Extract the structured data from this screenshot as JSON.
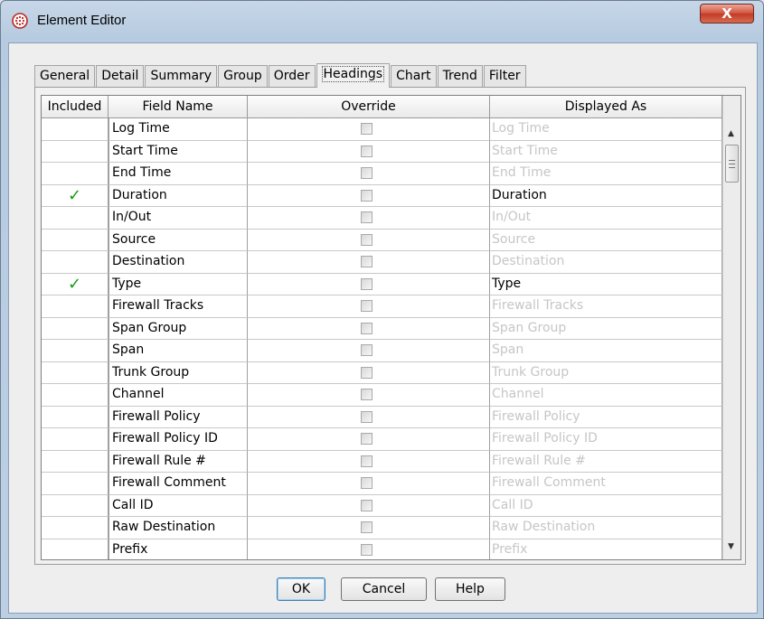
{
  "window": {
    "title": "Element Editor",
    "close_glyph": "X",
    "app_icon": "globe-logo-icon"
  },
  "tabs": [
    {
      "label": "General",
      "active": false
    },
    {
      "label": "Detail",
      "active": false
    },
    {
      "label": "Summary",
      "active": false
    },
    {
      "label": "Group",
      "active": false
    },
    {
      "label": "Order",
      "active": false
    },
    {
      "label": "Headings",
      "active": true
    },
    {
      "label": "Chart",
      "active": false
    },
    {
      "label": "Trend",
      "active": false
    },
    {
      "label": "Filter",
      "active": false
    }
  ],
  "table": {
    "columns": [
      "Included",
      "Field Name",
      "Override",
      "Displayed As"
    ],
    "rows": [
      {
        "included": false,
        "field": "Log Time",
        "override": false,
        "displayed": "Log Time"
      },
      {
        "included": false,
        "field": "Start Time",
        "override": false,
        "displayed": "Start Time"
      },
      {
        "included": false,
        "field": "End Time",
        "override": false,
        "displayed": "End Time"
      },
      {
        "included": true,
        "field": "Duration",
        "override": false,
        "displayed": "Duration"
      },
      {
        "included": false,
        "field": "In/Out",
        "override": false,
        "displayed": "In/Out"
      },
      {
        "included": false,
        "field": "Source",
        "override": false,
        "displayed": "Source"
      },
      {
        "included": false,
        "field": "Destination",
        "override": false,
        "displayed": "Destination"
      },
      {
        "included": true,
        "field": "Type",
        "override": false,
        "displayed": "Type"
      },
      {
        "included": false,
        "field": "Firewall Tracks",
        "override": false,
        "displayed": "Firewall Tracks"
      },
      {
        "included": false,
        "field": "Span Group",
        "override": false,
        "displayed": "Span Group"
      },
      {
        "included": false,
        "field": "Span",
        "override": false,
        "displayed": "Span"
      },
      {
        "included": false,
        "field": "Trunk Group",
        "override": false,
        "displayed": "Trunk Group"
      },
      {
        "included": false,
        "field": "Channel",
        "override": false,
        "displayed": "Channel"
      },
      {
        "included": false,
        "field": "Firewall Policy",
        "override": false,
        "displayed": "Firewall Policy"
      },
      {
        "included": false,
        "field": "Firewall Policy ID",
        "override": false,
        "displayed": "Firewall Policy ID"
      },
      {
        "included": false,
        "field": "Firewall Rule #",
        "override": false,
        "displayed": "Firewall Rule #"
      },
      {
        "included": false,
        "field": "Firewall Comment",
        "override": false,
        "displayed": "Firewall Comment"
      },
      {
        "included": false,
        "field": "Call ID",
        "override": false,
        "displayed": "Call ID"
      },
      {
        "included": false,
        "field": "Raw Destination",
        "override": false,
        "displayed": "Raw Destination"
      },
      {
        "included": false,
        "field": "Prefix",
        "override": false,
        "displayed": "Prefix"
      }
    ],
    "check_glyph": "✓"
  },
  "scrollbar": {
    "up_glyph": "▲",
    "down_glyph": "▼"
  },
  "buttons": {
    "ok": "OK",
    "cancel": "Cancel",
    "help": "Help"
  },
  "colors": {
    "check": "#1a9c1a",
    "dim_text": "#c6c6c6",
    "close_red": "#c23a24"
  }
}
